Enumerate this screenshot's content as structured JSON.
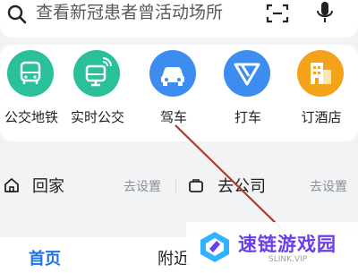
{
  "search": {
    "placeholder": "查看新冠患者曾活动场所",
    "search_icon": "search-icon",
    "scan_icon": "scan-icon",
    "mic_icon": "mic-icon"
  },
  "quick_actions": [
    {
      "label": "公交地铁",
      "icon": "bus-icon",
      "color": "#2ac09a"
    },
    {
      "label": "实时公交",
      "icon": "realtime-bus-icon",
      "color": "#2ac09a"
    },
    {
      "label": "驾车",
      "icon": "car-icon",
      "color": "#3d8cf0"
    },
    {
      "label": "打车",
      "icon": "taxi-icon",
      "color": "#3d8cf0"
    },
    {
      "label": "订酒店",
      "icon": "hotel-icon",
      "color": "#f5a21b"
    }
  ],
  "shortcuts": {
    "home": {
      "label": "回家",
      "action": "去设置",
      "icon": "home-icon"
    },
    "work": {
      "label": "去公司",
      "action": "去设置",
      "icon": "briefcase-icon"
    }
  },
  "tabs": [
    {
      "label": "首页",
      "active": true
    },
    {
      "label": "附近",
      "active": false
    }
  ],
  "watermark": {
    "title": "速链游戏园",
    "subtitle": "SLINK.VIP",
    "accent": "#6a3df0"
  },
  "colors": {
    "accent": "#1a73e8",
    "annotation_arrow": "#b5352a"
  }
}
